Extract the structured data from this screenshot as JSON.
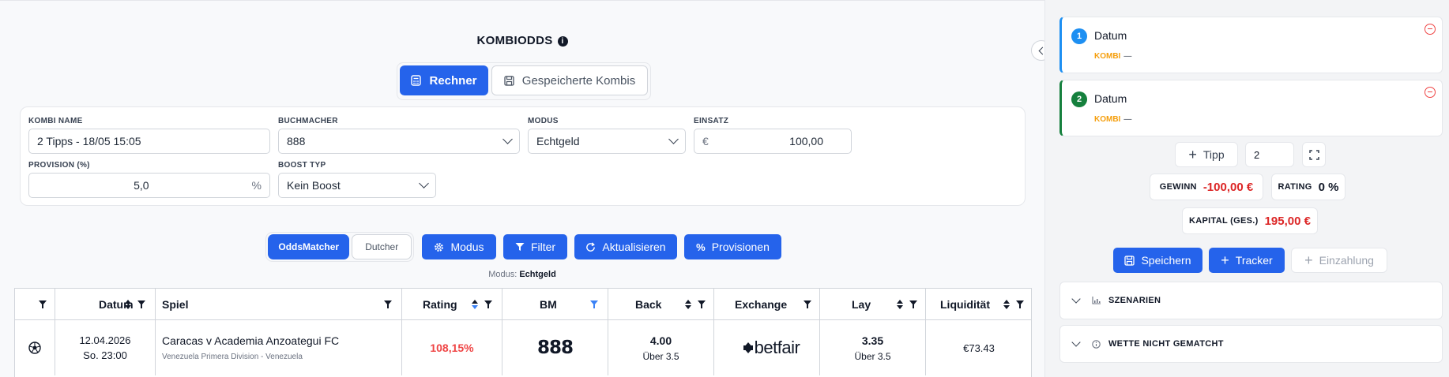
{
  "header": {
    "title": "KOMBIODDS",
    "info_icon": "info-circle-icon"
  },
  "view_tabs": {
    "calculator": "Rechner",
    "saved": "Gespeicherte Kombis"
  },
  "form": {
    "name_label": "KOMBI NAME",
    "name_value": "2 Tipps - 18/05 15:05",
    "bookmaker_label": "BUCHMACHER",
    "bookmaker_value": "888",
    "mode_label": "MODUS",
    "mode_value": "Echtgeld",
    "stake_label": "EINSATZ",
    "stake_currency": "€",
    "stake_value": "100,00",
    "commission_label": "PROVISION (%)",
    "commission_value": "5,0",
    "commission_unit": "%",
    "boost_label": "BOOST TYP",
    "boost_value": "Kein Boost"
  },
  "toolbar": {
    "oddsmatcher": "OddsMatcher",
    "dutcher": "Dutcher",
    "modus": "Modus",
    "filter": "Filter",
    "refresh": "Aktualisieren",
    "commissions": "Provisionen"
  },
  "mode_line": {
    "label": "Modus:",
    "value": "Echtgeld"
  },
  "table": {
    "headers": {
      "date": "Datum",
      "match": "Spiel",
      "rating": "Rating",
      "bm": "BM",
      "back": "Back",
      "exchange": "Exchange",
      "lay": "Lay",
      "liquidity": "Liquidität"
    },
    "rows": [
      {
        "sport_icon": "soccer-ball-icon",
        "date": "12.04.2026",
        "time": "So. 23:00",
        "match": "Caracas v Academia Anzoategui FC",
        "league": "Venezuela Primera Division - Venezuela",
        "rating": "108,15%",
        "bm": "888",
        "back_odds": "4.00",
        "back_market": "Über 3.5",
        "exchange": "betfair",
        "lay_odds": "3.35",
        "lay_market": "Über 3.5",
        "liquidity": "€73.43"
      }
    ]
  },
  "slip": {
    "legs": [
      {
        "number": "1",
        "name": "Datum",
        "tag": "KOMBI",
        "value": "—",
        "color": "#1d8ff2"
      },
      {
        "number": "2",
        "name": "Datum",
        "tag": "KOMBI",
        "value": "—",
        "color": "#15803d"
      }
    ],
    "add_tip": "Tipp",
    "tip_count": "2",
    "profit_label": "GEWINN",
    "profit_value": "-100,00 €",
    "rating_label": "RATING",
    "rating_value": "0 %",
    "capital_label": "KAPITAL (GES.)",
    "capital_value": "195,00 €",
    "save": "Speichern",
    "tracker": "Tracker",
    "deposit": "Einzahlung",
    "scenarios": "SZENARIEN",
    "unmatched": "WETTE NICHT GEMATCHT"
  },
  "colors": {
    "primary": "#2563eb",
    "negative": "#dc2626",
    "kombi_tag": "#f59e0b"
  }
}
